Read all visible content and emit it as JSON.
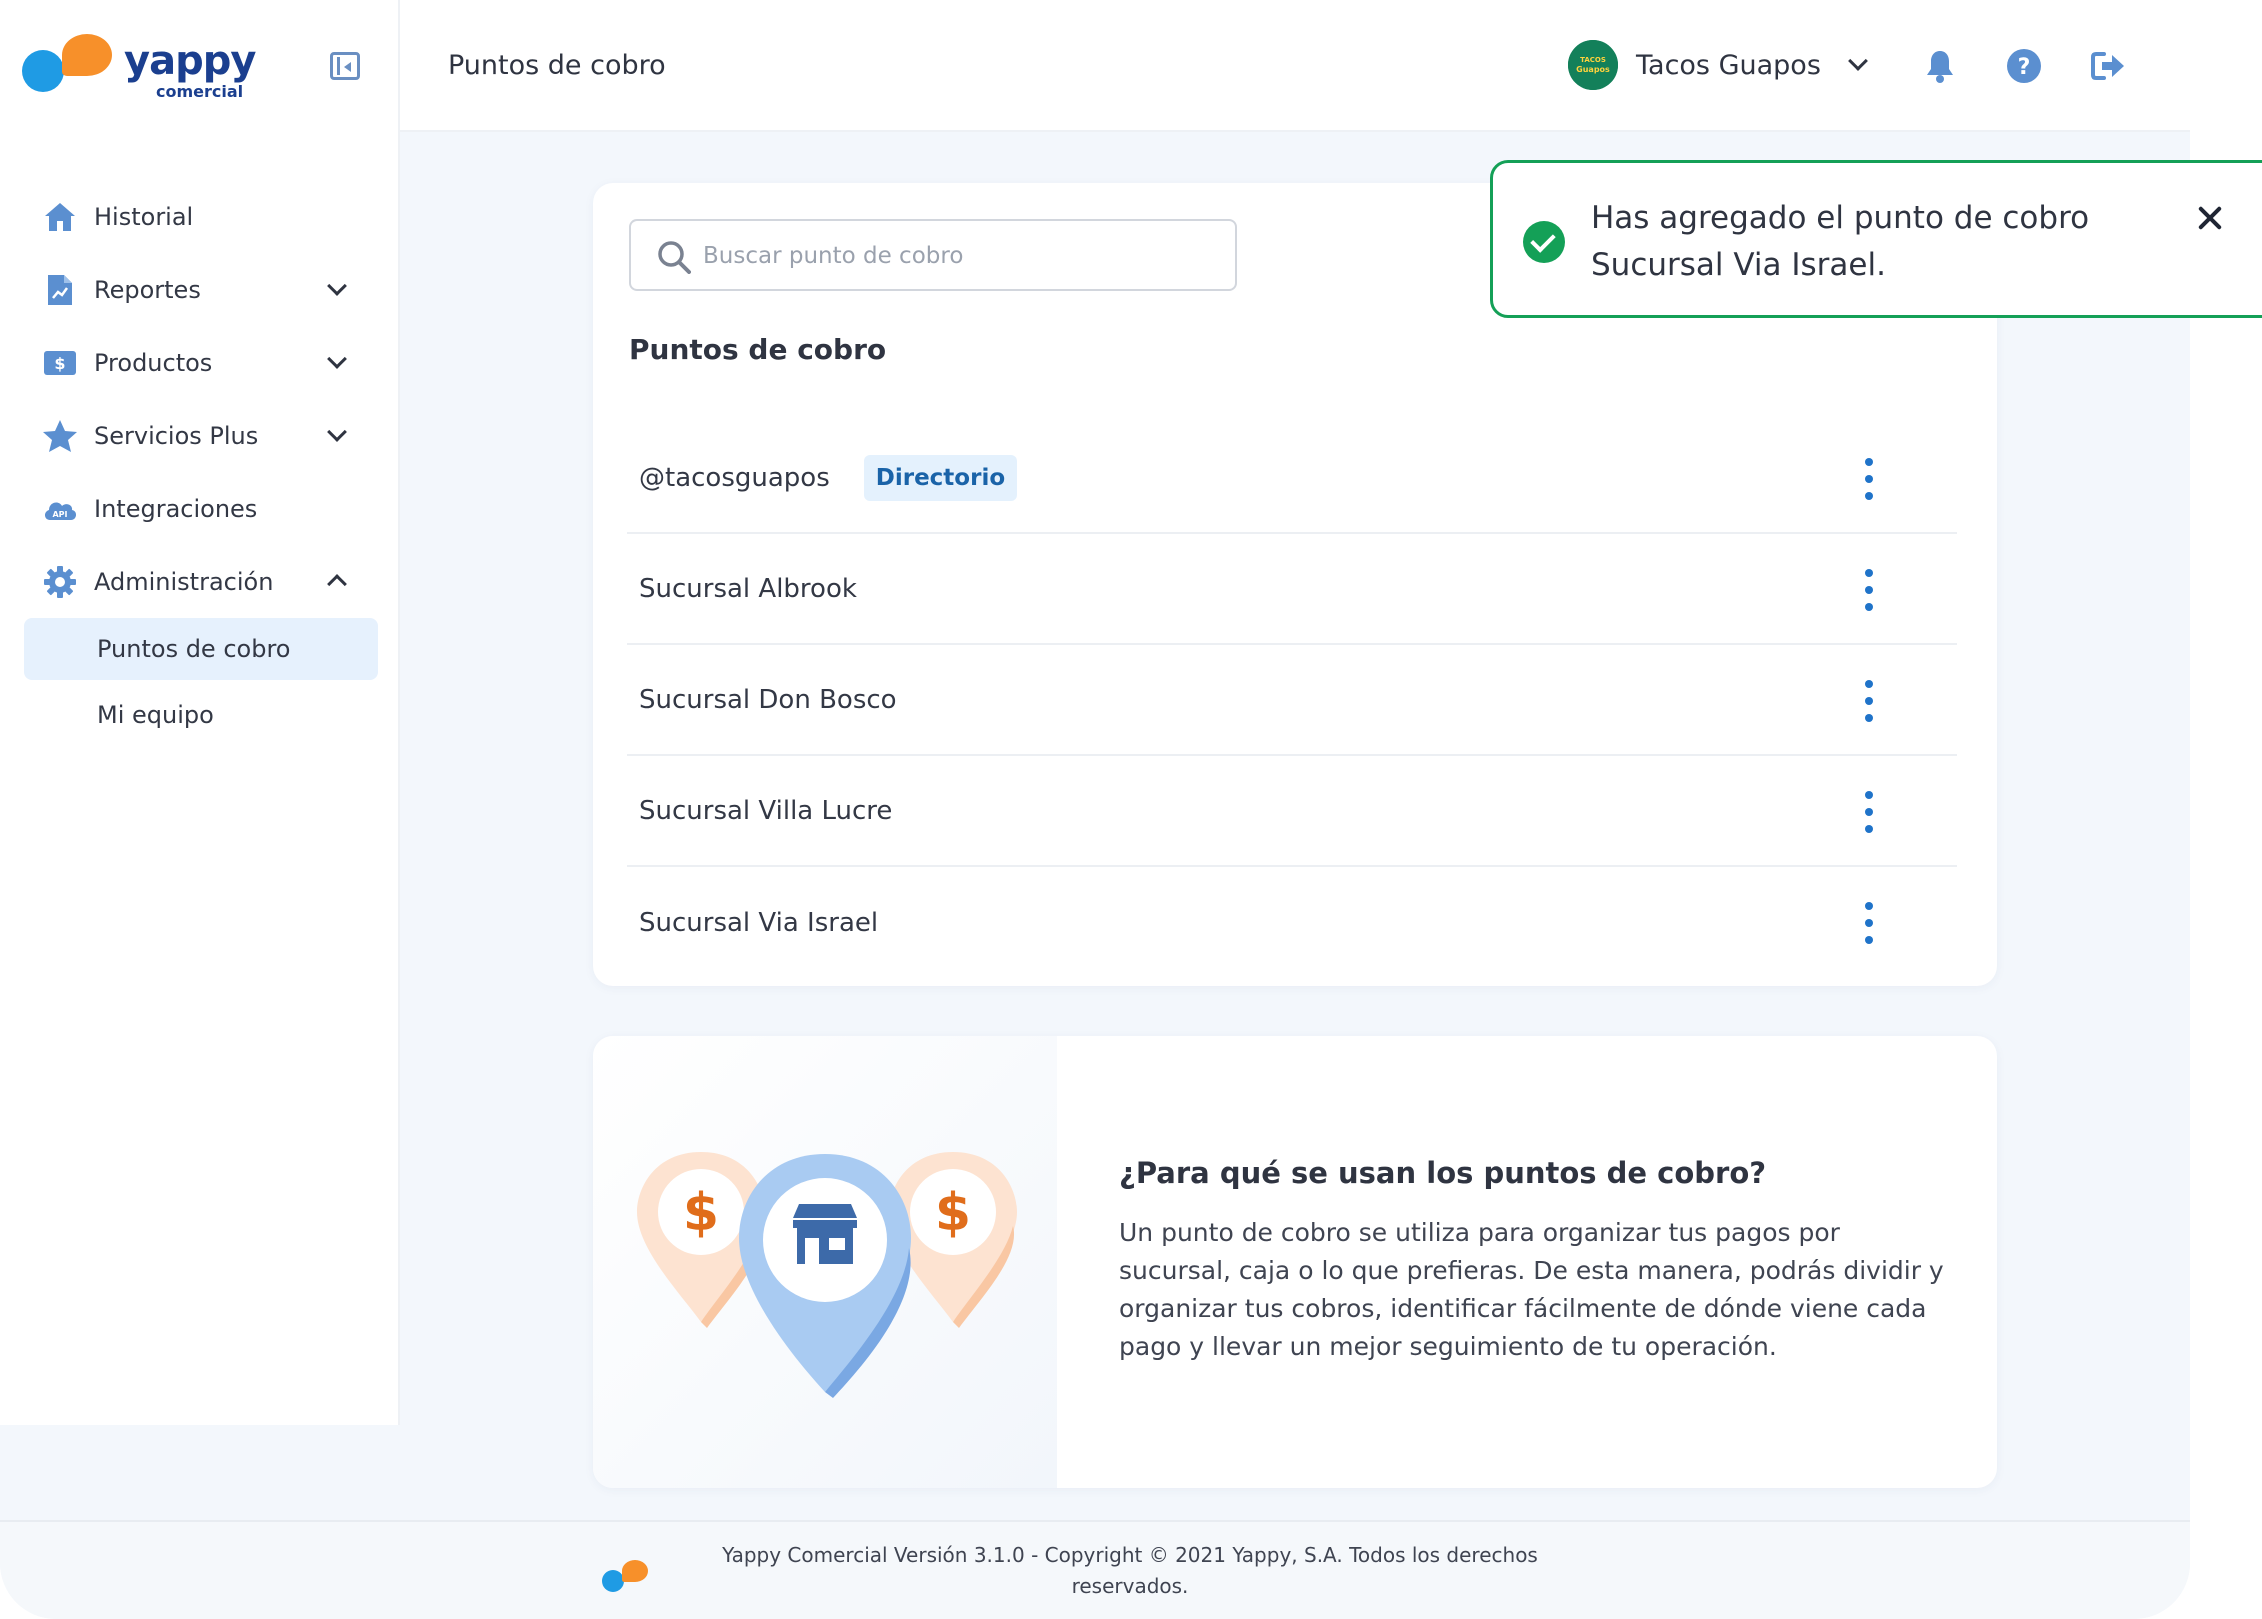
{
  "brand": {
    "name": "yappy",
    "subtitle": "comercial",
    "colors": {
      "blue": "#1f9be4",
      "orange": "#f7902a",
      "navy": "#1b3f8f"
    }
  },
  "header": {
    "title": "Puntos de cobro",
    "merchant_name": "Tacos Guapos",
    "merchant_avatar_text": "TACOS GUAPOS",
    "icons": [
      "bell-icon",
      "help-icon",
      "logout-icon"
    ]
  },
  "sidebar": {
    "items": [
      {
        "label": "Historial",
        "icon": "home-icon",
        "expandable": false
      },
      {
        "label": "Reportes",
        "icon": "report-icon",
        "expandable": true
      },
      {
        "label": "Productos",
        "icon": "dollar-icon",
        "expandable": true
      },
      {
        "label": "Servicios Plus",
        "icon": "star-icon",
        "expandable": true
      },
      {
        "label": "Integraciones",
        "icon": "api-cloud-icon",
        "expandable": false
      },
      {
        "label": "Administración",
        "icon": "gear-icon",
        "expandable": true,
        "expanded": true
      }
    ],
    "sub_items": [
      {
        "label": "Puntos de cobro",
        "active": true
      },
      {
        "label": "Mi equipo",
        "active": false
      }
    ],
    "active_color": "#e6f1fd"
  },
  "search": {
    "placeholder": "Buscar punto de cobro",
    "value": ""
  },
  "list": {
    "title": "Puntos de cobro",
    "rows": [
      {
        "name": "@tacosguapos",
        "badge": "Directorio"
      },
      {
        "name": "Sucursal Albrook",
        "badge": ""
      },
      {
        "name": "Sucursal Don Bosco",
        "badge": ""
      },
      {
        "name": "Sucursal Villa Lucre",
        "badge": ""
      },
      {
        "name": "Sucursal Via Israel",
        "badge": ""
      }
    ]
  },
  "info": {
    "title": "¿Para qué se usan los puntos de cobro?",
    "body": "Un punto de cobro se utiliza para organizar tus pagos por sucursal, caja o lo que prefieras. De esta manera, podrás dividir y organizar tus cobros, identificar fácilmente de dónde viene cada pago y llevar un mejor seguimiento de tu operación.",
    "illustration_symbol": "$"
  },
  "toast": {
    "message": "Has agregado el punto de cobro Sucursal Via Israel.",
    "status_color": "#14a057"
  },
  "footer": {
    "text": "Yappy Comercial Versión 3.1.0  -  Copyright © 2021 Yappy, S.A. Todos los derechos reservados."
  }
}
